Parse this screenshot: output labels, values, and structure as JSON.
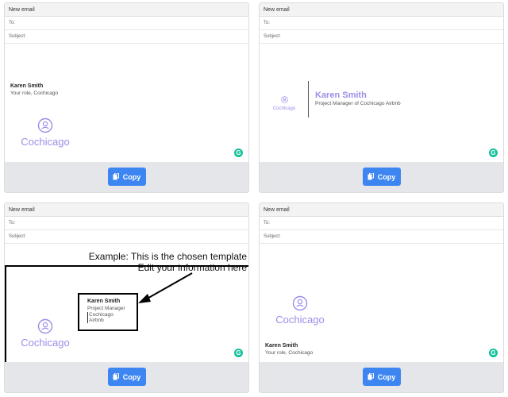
{
  "window_header": "New email",
  "fields": {
    "to_label": "To:",
    "subject_label": "Subject:"
  },
  "copy_label": "Copy",
  "grammarly_glyph": "G",
  "logo": {
    "text": "Cochicago",
    "icon": "user-circle-icon"
  },
  "colors": {
    "accent": "#3d86f2",
    "logo": "#9b8ee8",
    "grammarly": "#15c39a",
    "footer": "#e5e6ea"
  },
  "cards": [
    {
      "name": "Karen Smith",
      "role_line": "Your role, Cochicago"
    },
    {
      "name": "Karen Smith",
      "role_line": "Project Manager of Cochicago Airbnb"
    },
    {
      "name": "Karen Smith",
      "title": "Project Manager",
      "company": "Cochicago Airbnb",
      "annotation_line1": "Example: This is the chosen template",
      "annotation_line2": "Edit your information here"
    },
    {
      "name": "Karen Smith",
      "role_line": "Your role, Cochicago"
    }
  ]
}
